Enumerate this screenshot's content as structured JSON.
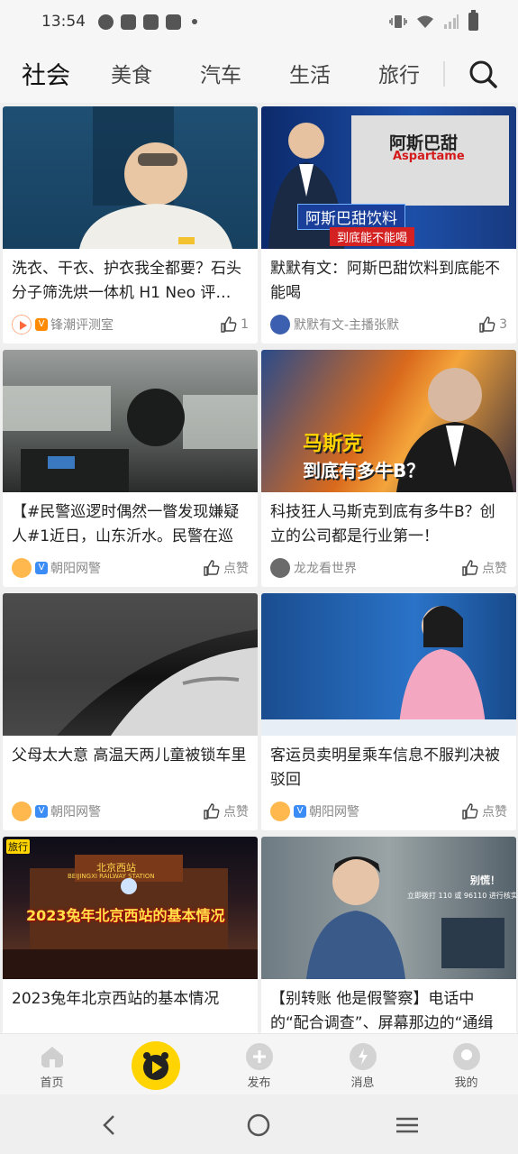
{
  "status_bar": {
    "time": "13:54"
  },
  "tabs": [
    {
      "label": "社会",
      "active": true
    },
    {
      "label": "美食"
    },
    {
      "label": "汽车"
    },
    {
      "label": "生活"
    },
    {
      "label": "旅行"
    }
  ],
  "feed": {
    "left": [
      {
        "title": "洗衣、干衣、护衣我全都要？石头分子筛洗烘一体机 H1 Neo 评…",
        "author": "锋潮评测室",
        "verified_badge": "V",
        "likes": "1"
      },
      {
        "title": "【#民警巡逻时偶然一瞥发现嫌疑人#1近日，山东沂水。民警在巡逻…",
        "author": "朝阳网警",
        "verified_badge": "V",
        "likes": "点赞"
      },
      {
        "title": "父母太大意 高温天两儿童被锁车里",
        "author": "朝阳网警",
        "verified_badge": "V",
        "likes": "点赞"
      },
      {
        "title": "2023兔年北京西站的基本情况",
        "thumb_tag": "旅行",
        "thumb_caption": "2023兔年北京西站的基本情况",
        "thumb_sign": "北京西站",
        "thumb_sign_en": "BEIJINGXI RAILWAY STATION"
      }
    ],
    "right": [
      {
        "title": "默默有文：阿斯巴甜饮料到底能不能喝",
        "author": "默默有文-主播张默",
        "likes": "3",
        "thumb_banner": "阿斯巴甜饮料",
        "thumb_sub": "到底能不能喝",
        "thumb_product_cn": "阿斯巴甜",
        "thumb_product_en": "Aspartame"
      },
      {
        "title": "科技狂人马斯克到底有多牛B？创立的公司都是行业第一！",
        "author": "龙龙看世界",
        "likes": "点赞",
        "thumb_line1": "马斯克",
        "thumb_line2": "到底有多牛B？"
      },
      {
        "title": "客运员卖明星乘车信息不服判决被驳回",
        "author": "朝阳网警",
        "verified_badge": "V",
        "likes": "点赞"
      },
      {
        "title": "【别转账 他是假警察】电话中的“配合调查”、屏幕那边的“通缉令”…",
        "thumb_text1": "别慌！",
        "thumb_text2": "立即拨打 110 或 96110 进行核实"
      }
    ]
  },
  "bottom_nav": [
    {
      "label": "首页",
      "icon": "home-icon"
    },
    {
      "label": "",
      "icon": "video-center-icon"
    },
    {
      "label": "发布",
      "icon": "publish-icon"
    },
    {
      "label": "消息",
      "icon": "message-icon"
    },
    {
      "label": "我的",
      "icon": "profile-icon"
    }
  ],
  "colors": {
    "accent": "#ffd400",
    "verified": "#3b8cf5",
    "verified_orange": "#ff8a00"
  }
}
